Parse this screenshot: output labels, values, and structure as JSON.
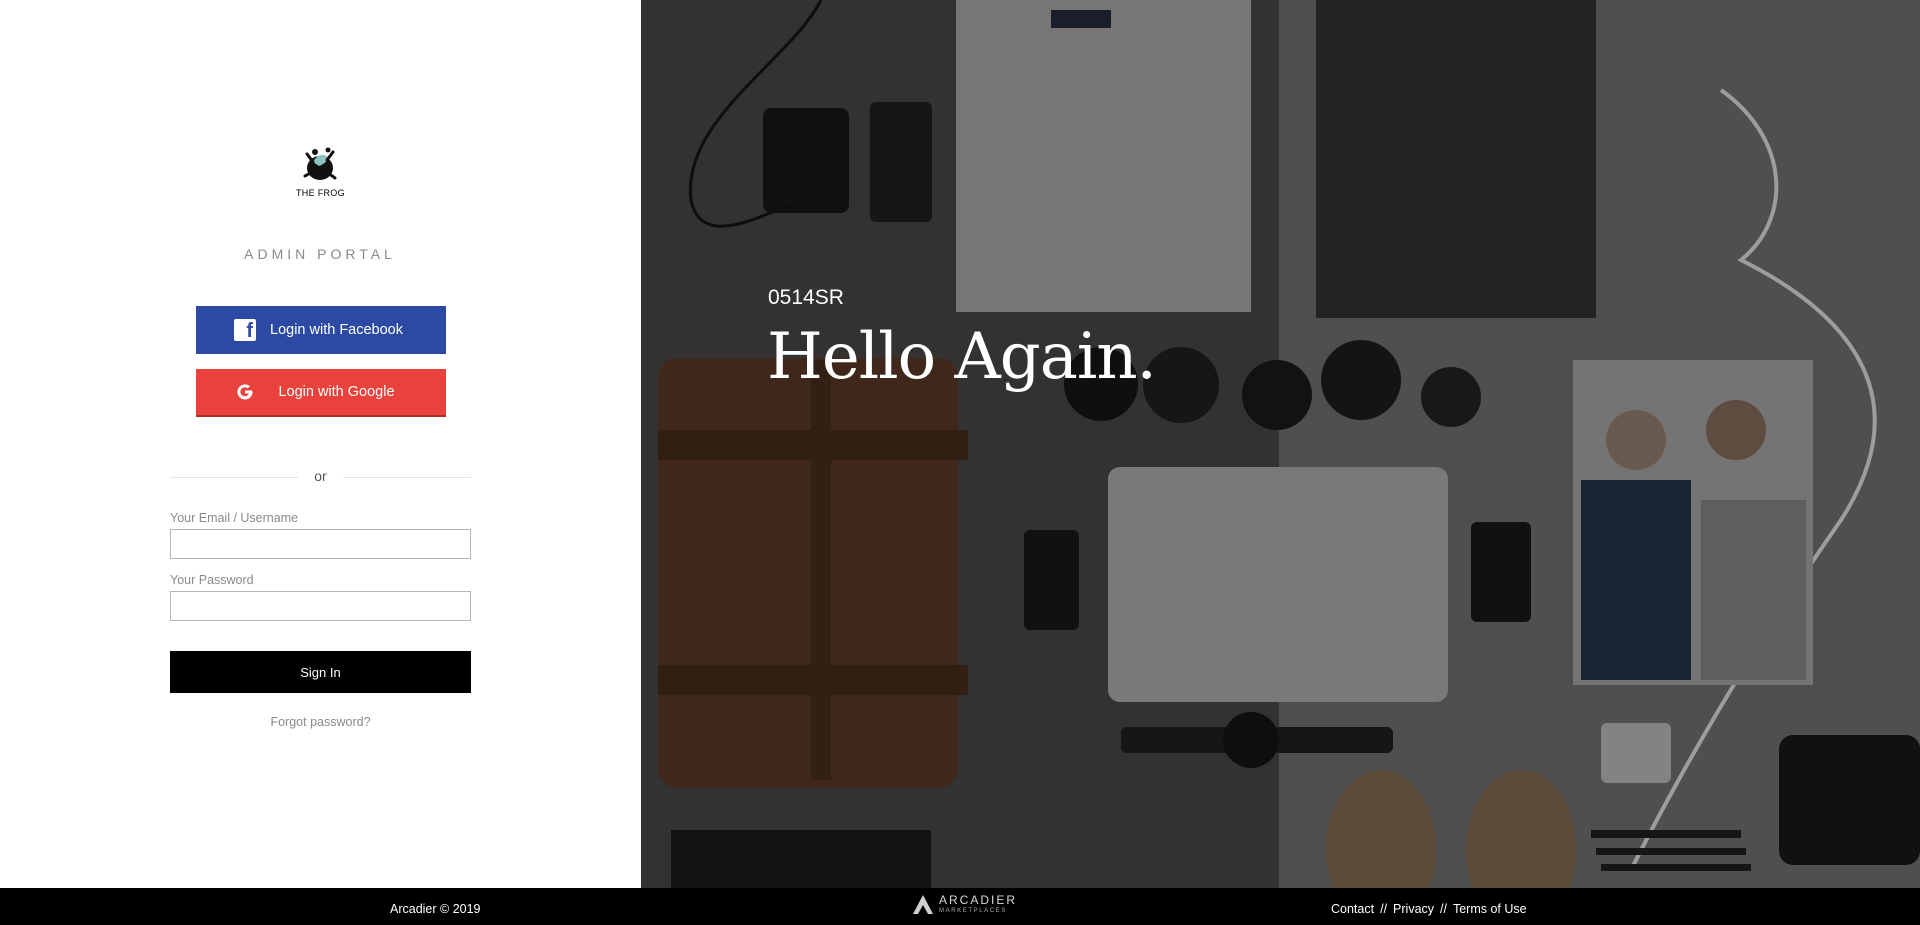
{
  "brand_logo": {
    "text": "THE FROG"
  },
  "portal_title": "ADMIN PORTAL",
  "facebook_button": {
    "label": "Login with Facebook",
    "icon": "facebook-icon",
    "color": "#2c4aa3"
  },
  "google_button": {
    "label": "Login with Google",
    "icon": "google-icon",
    "color": "#e9413b"
  },
  "divider_text": "or",
  "form": {
    "email_label": "Your Email / Username",
    "email_value": "",
    "password_label": "Your Password",
    "password_value": "",
    "signin_label": "Sign In",
    "forgot_label": "Forgot password?"
  },
  "hero": {
    "code": "0514SR",
    "title": "Hello Again."
  },
  "footer": {
    "copyright": "Arcadier © 2019",
    "brand_name": "ARCADIER",
    "brand_sub": "MARKETPLACES",
    "separator": "//",
    "links": [
      "Contact",
      "Privacy",
      "Terms of Use"
    ]
  }
}
